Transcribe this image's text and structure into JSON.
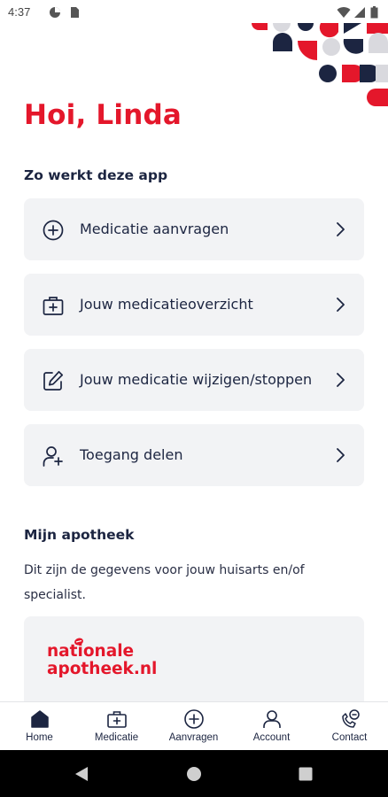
{
  "status_bar": {
    "time": "4:37",
    "icons": [
      "data-saver-icon",
      "sim-card-icon",
      "wifi-icon",
      "signal-icon",
      "battery-icon"
    ]
  },
  "greeting": "Hoi, Linda",
  "how_it_works": {
    "title": "Zo werkt deze app",
    "items": [
      {
        "label": "Medicatie aanvragen",
        "icon": "plus-circle-icon"
      },
      {
        "label": "Jouw medicatieoverzicht",
        "icon": "medical-kit-icon"
      },
      {
        "label": "Jouw medicatie wijzigen/stoppen",
        "icon": "edit-icon"
      },
      {
        "label": "Toegang delen",
        "icon": "add-user-icon"
      }
    ]
  },
  "my_pharmacy": {
    "title": "Mijn apotheek",
    "description": "Dit zijn de gegevens voor jouw huisarts en/of specialist.",
    "logo_line1": "nationale",
    "logo_line2": "apotheek.nl"
  },
  "bottom_nav": {
    "items": [
      {
        "label": "Home",
        "icon": "home-icon",
        "active": true
      },
      {
        "label": "Medicatie",
        "icon": "medical-kit-icon",
        "active": false
      },
      {
        "label": "Aanvragen",
        "icon": "plus-circle-icon",
        "active": false
      },
      {
        "label": "Account",
        "icon": "user-icon",
        "active": false
      },
      {
        "label": "Contact",
        "icon": "phone-chat-icon",
        "active": false
      }
    ]
  },
  "colors": {
    "brand_red": "#e4172b",
    "navy": "#1c2541",
    "card_bg": "#f2f3f5",
    "deco_grey": "#d9d9de"
  }
}
